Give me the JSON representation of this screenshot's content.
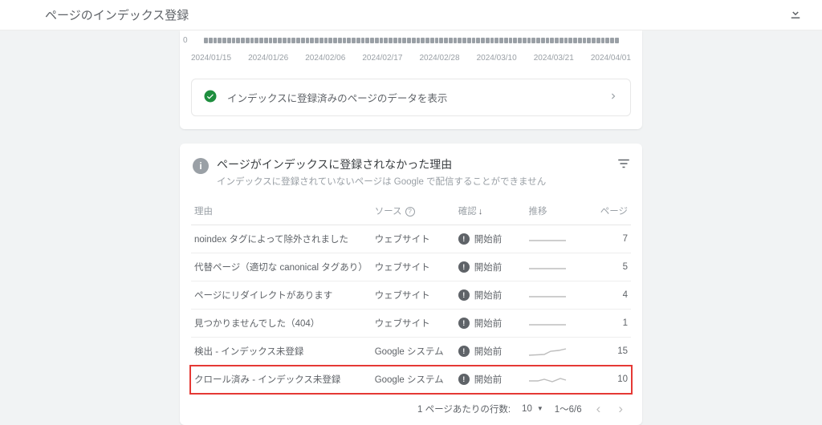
{
  "header": {
    "title": "ページのインデックス登録"
  },
  "chart_data": {
    "type": "bar",
    "categories": [
      "2024/01/15",
      "2024/01/26",
      "2024/02/06",
      "2024/02/17",
      "2024/02/28",
      "2024/03/10",
      "2024/03/21",
      "2024/04/01"
    ],
    "values": [
      1,
      1,
      1,
      1,
      1,
      1,
      1,
      1,
      1,
      1,
      1,
      1,
      1,
      1,
      1,
      1,
      1,
      1,
      1,
      1,
      1,
      1,
      1,
      1,
      1,
      1,
      1,
      1,
      1,
      1,
      1,
      1,
      1,
      1,
      1,
      1,
      1,
      1,
      1,
      1,
      1,
      1,
      1,
      1,
      1,
      1,
      1,
      1,
      1,
      1,
      1,
      1,
      1,
      1,
      1,
      1,
      1,
      1,
      1,
      1,
      1,
      1,
      1,
      1,
      1,
      1,
      1,
      1,
      1,
      1,
      1,
      1,
      1,
      1,
      1,
      1,
      1,
      1,
      1,
      1,
      1,
      1,
      1,
      1,
      1,
      1,
      1,
      1,
      1,
      1
    ],
    "ylim": [
      0,
      1
    ],
    "zero_label": "0"
  },
  "disclosure": {
    "label": "インデックスに登録済みのページのデータを表示"
  },
  "reasons": {
    "title": "ページがインデックスに登録されなかった理由",
    "subtitle": "インデックスに登録されていないページは Google で配信することができません",
    "columns": {
      "reason": "理由",
      "source": "ソース",
      "verify": "確認",
      "trend": "推移",
      "pages": "ページ"
    },
    "rows": [
      {
        "reason": "noindex タグによって除外されました",
        "source": "ウェブサイト",
        "verify": "開始前",
        "pages": "7",
        "spark": "flat"
      },
      {
        "reason": "代替ページ（適切な canonical タグあり）",
        "source": "ウェブサイト",
        "verify": "開始前",
        "pages": "5",
        "spark": "flat"
      },
      {
        "reason": "ページにリダイレクトがあります",
        "source": "ウェブサイト",
        "verify": "開始前",
        "pages": "4",
        "spark": "flat"
      },
      {
        "reason": "見つかりませんでした（404）",
        "source": "ウェブサイト",
        "verify": "開始前",
        "pages": "1",
        "spark": "flat"
      },
      {
        "reason": "検出 - インデックス未登録",
        "source": "Google システム",
        "verify": "開始前",
        "pages": "15",
        "spark": "rise"
      },
      {
        "reason": "クロール済み - インデックス未登録",
        "source": "Google システム",
        "verify": "開始前",
        "pages": "10",
        "spark": "wavy"
      }
    ],
    "highlight_row": 5
  },
  "pagination": {
    "rows_label": "1 ページあたりの行数:",
    "rows_value": "10",
    "range": "1～6/6"
  }
}
